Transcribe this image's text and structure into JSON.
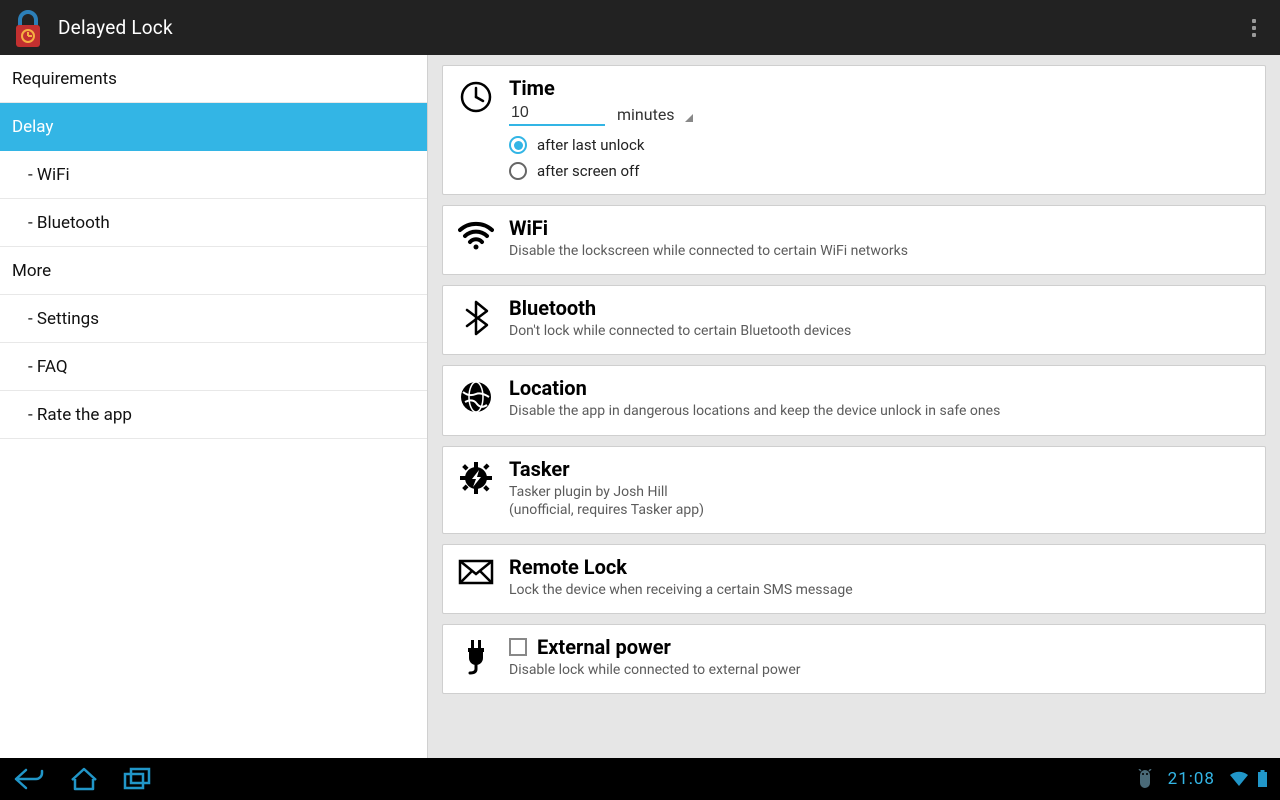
{
  "header": {
    "title": "Delayed Lock"
  },
  "sidebar": {
    "items": [
      {
        "label": "Requirements",
        "indent": false,
        "selected": false
      },
      {
        "label": "Delay",
        "indent": false,
        "selected": true
      },
      {
        "label": "- WiFi",
        "indent": true,
        "selected": false
      },
      {
        "label": "- Bluetooth",
        "indent": true,
        "selected": false
      },
      {
        "label": "More",
        "indent": false,
        "selected": false
      },
      {
        "label": "- Settings",
        "indent": true,
        "selected": false
      },
      {
        "label": "- FAQ",
        "indent": true,
        "selected": false
      },
      {
        "label": "- Rate the app",
        "indent": true,
        "selected": false
      }
    ]
  },
  "time": {
    "title": "Time",
    "value": "10",
    "unit": "minutes",
    "radio1": "after last unlock",
    "radio2": "after screen off",
    "selected": "after last unlock"
  },
  "cards": {
    "wifi": {
      "title": "WiFi",
      "desc": "Disable the lockscreen while connected to certain WiFi networks"
    },
    "bluetooth": {
      "title": "Bluetooth",
      "desc": "Don't lock while connected to certain Bluetooth devices"
    },
    "location": {
      "title": "Location",
      "desc": "Disable the app in dangerous locations and keep the device unlock in safe ones"
    },
    "tasker": {
      "title": "Tasker",
      "desc": "Tasker plugin by Josh Hill",
      "desc2": "(unofficial, requires Tasker app)"
    },
    "remote": {
      "title": "Remote Lock",
      "desc": "Lock the device when receiving a certain SMS message"
    },
    "power": {
      "title": "External power",
      "desc": "Disable lock while connected to external power"
    }
  },
  "status": {
    "clock": "21:08"
  }
}
